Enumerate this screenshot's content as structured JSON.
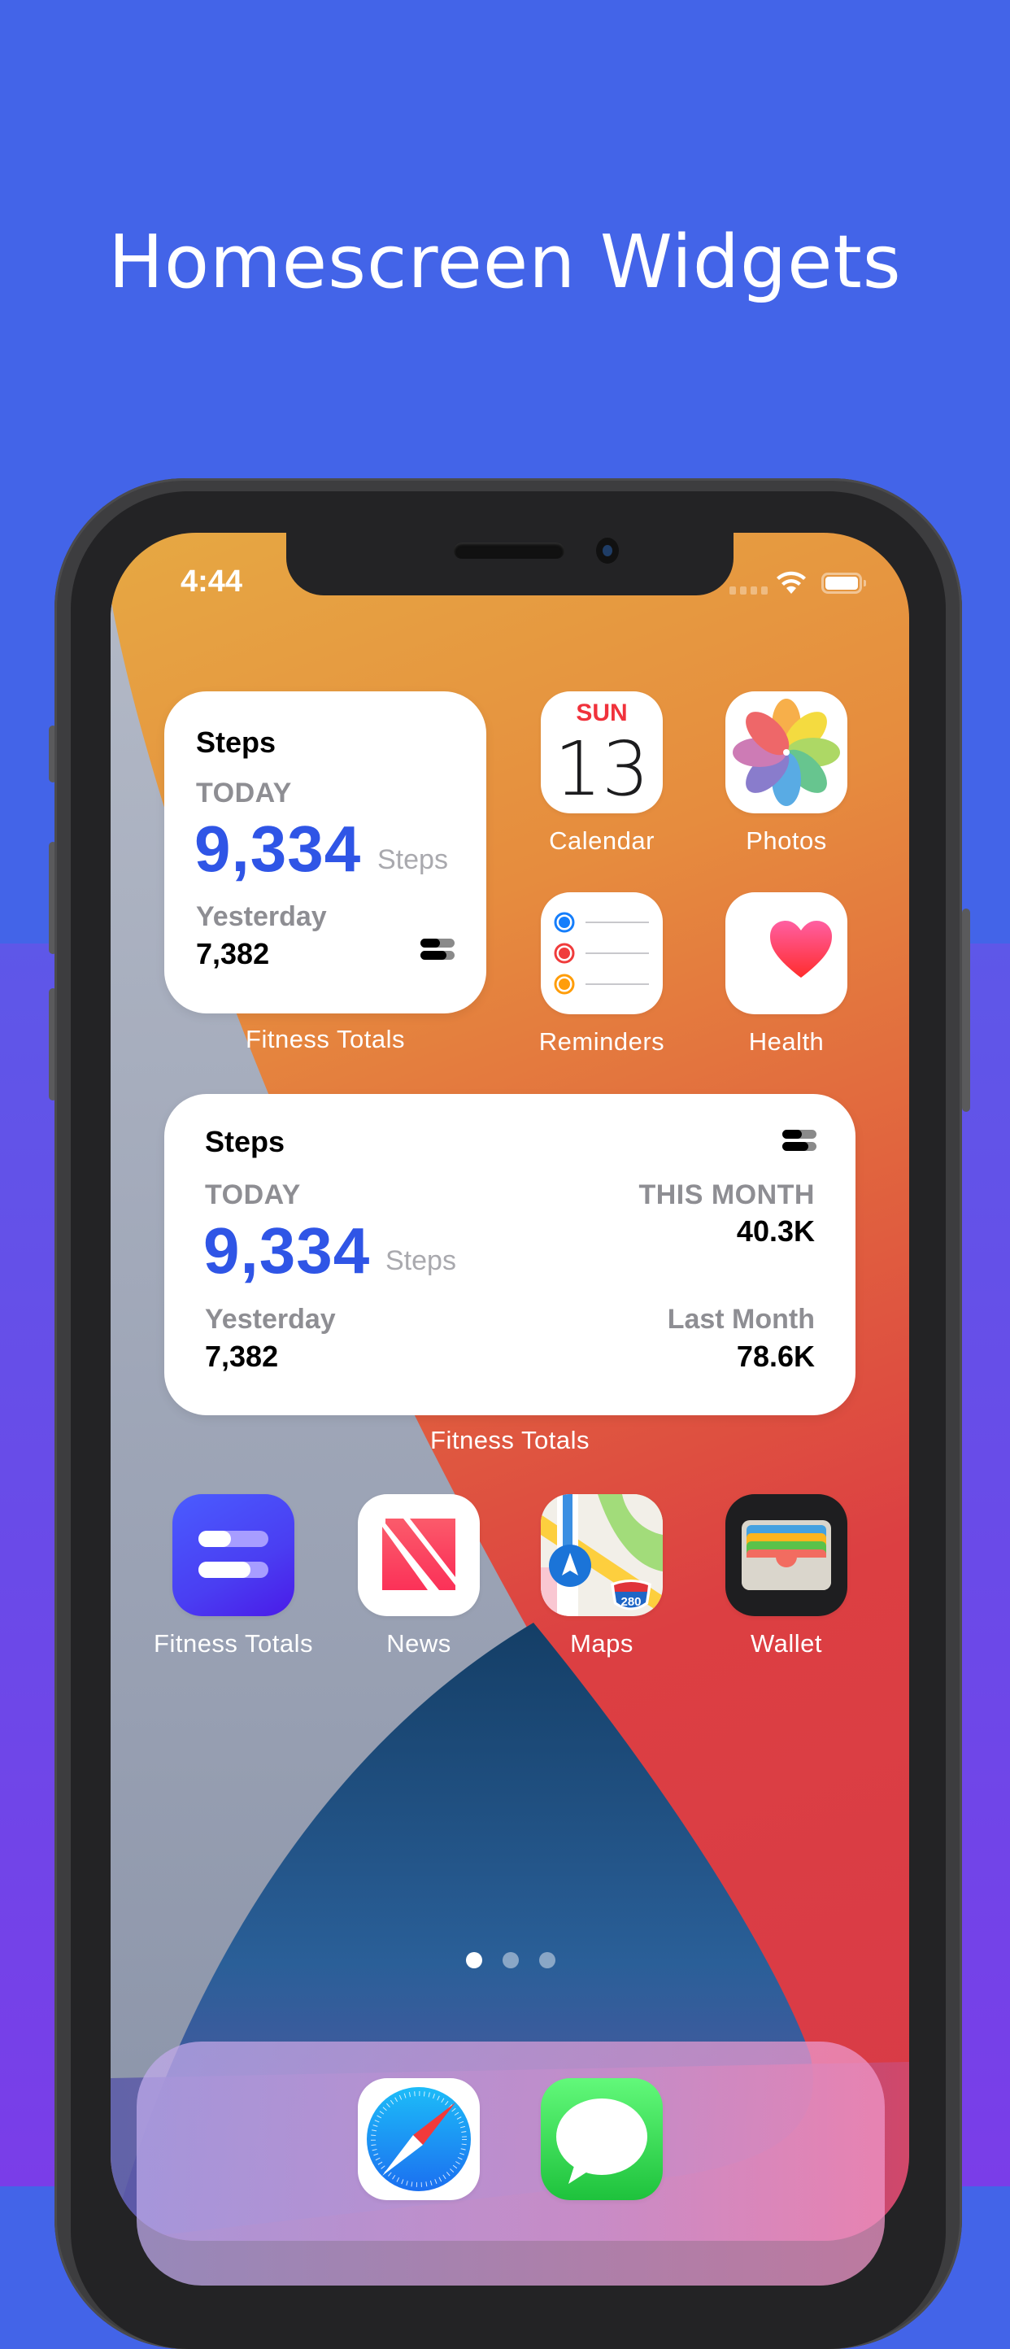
{
  "headline": "Homescreen Widgets",
  "status_bar": {
    "time": "4:44",
    "wifi_icon": "wifi-icon",
    "battery_icon": "battery-icon"
  },
  "colors": {
    "accent_blue": "#2f55e6",
    "secondary_gray": "#8e8e93",
    "background_top": "#4364e8",
    "background_bottom": "#7a3de8"
  },
  "small_widget": {
    "title": "Steps",
    "today_label": "TODAY",
    "today_value": "9,334",
    "unit": "Steps",
    "yesterday_label": "Yesterday",
    "yesterday_value": "7,382",
    "app_name": "Fitness Totals"
  },
  "medium_widget": {
    "title": "Steps",
    "today_label": "TODAY",
    "today_value": "9,334",
    "unit": "Steps",
    "yesterday_label": "Yesterday",
    "yesterday_value": "7,382",
    "this_month_label": "THIS MONTH",
    "this_month_value": "40.3K",
    "last_month_label": "Last Month",
    "last_month_value": "78.6K",
    "app_name": "Fitness Totals"
  },
  "calendar": {
    "day": "SUN",
    "date": "13"
  },
  "apps": [
    {
      "name": "Calendar",
      "icon": "calendar-icon"
    },
    {
      "name": "Photos",
      "icon": "photos-icon"
    },
    {
      "name": "Reminders",
      "icon": "reminders-icon"
    },
    {
      "name": "Health",
      "icon": "health-icon"
    },
    {
      "name": "Fitness Totals",
      "icon": "fitness-totals-icon"
    },
    {
      "name": "News",
      "icon": "news-icon"
    },
    {
      "name": "Maps",
      "icon": "maps-icon"
    },
    {
      "name": "Wallet",
      "icon": "wallet-icon"
    }
  ],
  "maps_shield_number": "280",
  "page_indicator": {
    "pages": 3,
    "current": 1
  },
  "dock": [
    {
      "name": "Safari",
      "icon": "safari-icon"
    },
    {
      "name": "Messages",
      "icon": "messages-icon"
    }
  ]
}
